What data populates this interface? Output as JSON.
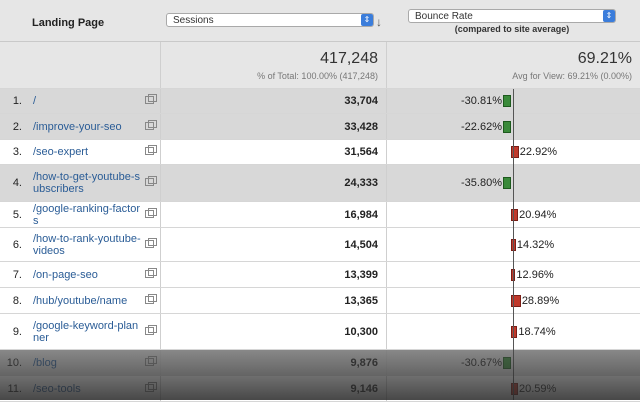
{
  "header": {
    "landing_page_label": "Landing Page",
    "primary_metric": "Sessions",
    "secondary_metric": "Bounce Rate",
    "comparison_caption": "(compared to site average)"
  },
  "totals": {
    "sessions": "417,248",
    "sessions_sub": "% of Total: 100.00% (417,248)",
    "bounce": "69.21%",
    "bounce_sub": "Avg for View: 69.21% (0.00%)"
  },
  "rows": [
    {
      "idx": "1.",
      "page": "/",
      "sessions": "33,704",
      "bounce": "-30.81%",
      "delta": -30.81
    },
    {
      "idx": "2.",
      "page": "/improve-your-seo",
      "sessions": "33,428",
      "bounce": "-22.62%",
      "delta": -22.62
    },
    {
      "idx": "3.",
      "page": "/seo-expert",
      "sessions": "31,564",
      "bounce": "22.92%",
      "delta": 22.92
    },
    {
      "idx": "4.",
      "page": "/how-to-get-youtube-subscribers",
      "sessions": "24,333",
      "bounce": "-35.80%",
      "delta": -35.8
    },
    {
      "idx": "5.",
      "page": "/google-ranking-factors",
      "sessions": "16,984",
      "bounce": "20.94%",
      "delta": 20.94
    },
    {
      "idx": "6.",
      "page": "/how-to-rank-youtube-videos",
      "sessions": "14,504",
      "bounce": "14.32%",
      "delta": 14.32
    },
    {
      "idx": "7.",
      "page": "/on-page-seo",
      "sessions": "13,399",
      "bounce": "12.96%",
      "delta": 12.96
    },
    {
      "idx": "8.",
      "page": "/hub/youtube/name",
      "sessions": "13,365",
      "bounce": "28.89%",
      "delta": 28.89
    },
    {
      "idx": "9.",
      "page": "/google-keyword-planner",
      "sessions": "10,300",
      "bounce": "18.74%",
      "delta": 18.74
    },
    {
      "idx": "10.",
      "page": "/blog",
      "sessions": "9,876",
      "bounce": "-30.67%",
      "delta": -30.67
    },
    {
      "idx": "11.",
      "page": "/seo-tools",
      "sessions": "9,146",
      "bounce": "20.59%",
      "delta": 20.59
    }
  ],
  "colors": {
    "positive": "#c0392b",
    "negative": "#3a8a3a",
    "link": "#2a5c96"
  }
}
